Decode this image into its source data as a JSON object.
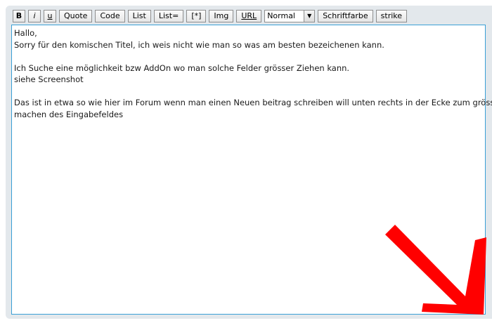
{
  "toolbar": {
    "bold_label": "B",
    "italic_label": "i",
    "underline_label": "u",
    "quote_label": "Quote",
    "code_label": "Code",
    "list_label": "List",
    "list_eq_label": "List=",
    "listitem_label": "[*]",
    "img_label": "Img",
    "url_label": "URL",
    "size_select_value": "Normal",
    "fontcolor_label": "Schriftfarbe",
    "strike_label": "strike"
  },
  "editor": {
    "lines": [
      "Hallo,",
      "Sorry für den komischen Titel, ich weis nicht wie man so was am besten bezeichenen kann.",
      "",
      "Ich Suche eine möglichkeit bzw AddOn wo man solche Felder grösser Ziehen kann.",
      "siehe Screenshot",
      "",
      "Das ist in etwa so wie hier im Forum wenn man einen Neuen beitrag schreiben will unten rechts in der Ecke zum grösser",
      "machen des Eingabefeldes"
    ]
  },
  "colors": {
    "panel_bg": "#e3e8ec",
    "editor_border": "#3aa0d6",
    "annotation_arrow": "#ff0000"
  },
  "icons": {
    "select_arrow": "triangle-down-icon",
    "resize_grip": "resize-grip-icon",
    "annotation": "red-arrow-annotation"
  }
}
